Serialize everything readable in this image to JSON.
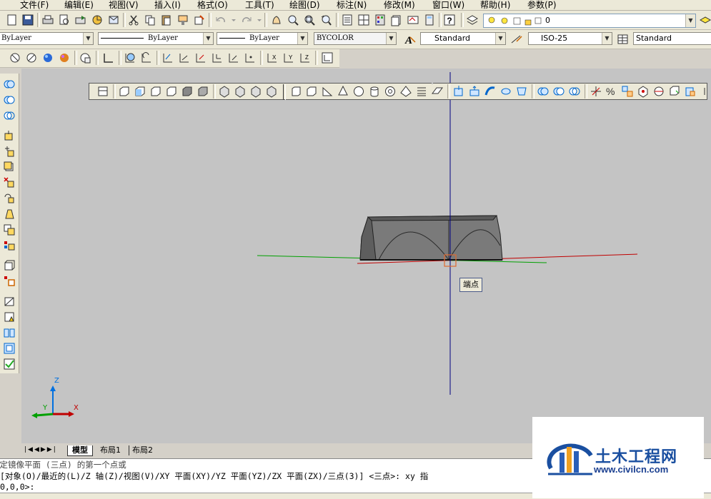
{
  "menu": [
    "文件(F)",
    "编辑(E)",
    "视图(V)",
    "插入(I)",
    "格式(O)",
    "工具(T)",
    "绘图(D)",
    "标注(N)",
    "修改(M)",
    "窗口(W)",
    "帮助(H)",
    "参数(P)"
  ],
  "layer": {
    "current": "0"
  },
  "properties": {
    "color": "ByLayer",
    "linetype": "ByLayer",
    "lineweight": "ByLayer",
    "plotstyle": "BYCOLOR"
  },
  "styles": {
    "text_style": "Standard",
    "dim_style": "ISO-25",
    "table_style": "Standard"
  },
  "tooltip": "端点",
  "ucs": {
    "x": "X",
    "y": "Y",
    "z": "Z"
  },
  "tabs": {
    "model": "模型",
    "layout1": "布局1",
    "layout2": "布局2"
  },
  "command": {
    "line1": "指定镜像平面 (三点) 的第一个点或",
    "line2": " [对象(O)/最近的(L)/Z 轴(Z)/视图(V)/XY 平面(XY)/YZ 平面(YZ)/ZX 平面(ZX)/三点(3)] <三点>: xy 指",
    "line3": "0,0,0>:"
  },
  "watermark": {
    "brand": "土木工程网",
    "url": "www.civilcn.com"
  },
  "colors": {
    "canvas": "#c4c4c4",
    "x_axis": "#c00000",
    "y_axis": "#00a000",
    "z_axis": "#0000a0",
    "crosshair": "#000080"
  }
}
